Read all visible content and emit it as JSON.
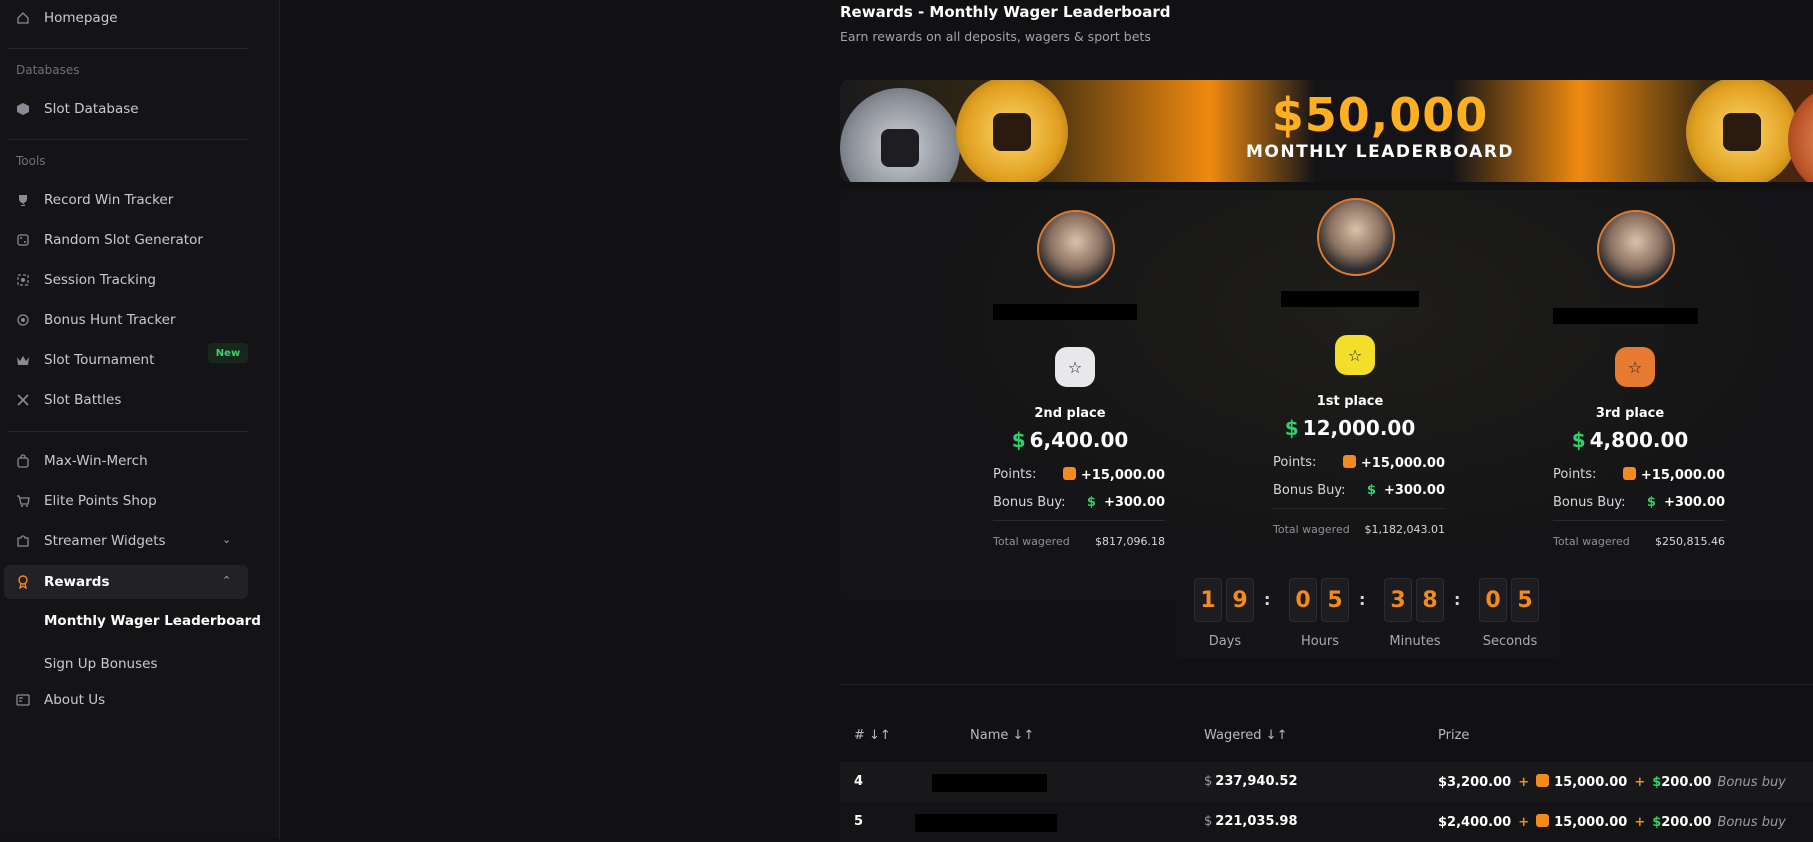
{
  "sidebar": {
    "homepage": "Homepage",
    "databases_title": "Databases",
    "slot_database": "Slot Database",
    "tools_title": "Tools",
    "record_win_tracker": "Record Win Tracker",
    "random_slot_generator": "Random Slot Generator",
    "session_tracking": "Session Tracking",
    "bonus_hunt_tracker": "Bonus Hunt Tracker",
    "slot_tournament": "Slot Tournament",
    "new_badge": "New",
    "slot_battles": "Slot Battles",
    "max_win_merch": "Max-Win-Merch",
    "elite_points_shop": "Elite Points Shop",
    "streamer_widgets": "Streamer Widgets",
    "rewards": "Rewards",
    "monthly_wager_leaderboard": "Monthly Wager Leaderboard",
    "sign_up_bonuses": "Sign Up Bonuses",
    "about_us": "About Us"
  },
  "header": {
    "title": "Rewards - Monthly Wager Leaderboard",
    "subtitle": "Earn rewards on all deposits, wagers & sport bets"
  },
  "banner": {
    "amount": "$50,000",
    "label": "MONTHLY LEADERBOARD"
  },
  "podium": {
    "points_label": "Points:",
    "bonus_buy_label": "Bonus Buy:",
    "total_wagered_label": "Total wagered",
    "currency": "$",
    "second": {
      "place": "2nd place",
      "amount": "6,400.00",
      "points": "+15,000.00",
      "bonus_buy": "+300.00",
      "total_wagered": "$817,096.18"
    },
    "first": {
      "place": "1st place",
      "amount": "12,000.00",
      "points": "+15,000.00",
      "bonus_buy": "+300.00",
      "total_wagered": "$1,182,043.01"
    },
    "third": {
      "place": "3rd place",
      "amount": "4,800.00",
      "points": "+15,000.00",
      "bonus_buy": "+300.00",
      "total_wagered": "$250,815.46"
    }
  },
  "countdown": {
    "days": [
      "1",
      "9"
    ],
    "hours": [
      "0",
      "5"
    ],
    "minutes": [
      "3",
      "8"
    ],
    "seconds": [
      "0",
      "5"
    ],
    "separator": ":",
    "labels": {
      "days": "Days",
      "hours": "Hours",
      "minutes": "Minutes",
      "seconds": "Seconds"
    }
  },
  "table": {
    "headers": {
      "rank": "# ↓↑",
      "name": "Name ↓↑",
      "wagered": "Wagered ↓↑",
      "prize": "Prize"
    },
    "rows": [
      {
        "rank": "4",
        "wagered": "237,940.52",
        "prize_cash": "$3,200.00",
        "prize_points": "15,000.00",
        "prize_bonus": "200.00",
        "bonus_label": "Bonus buy"
      },
      {
        "rank": "5",
        "wagered": "221,035.98",
        "prize_cash": "$2,400.00",
        "prize_points": "15,000.00",
        "prize_bonus": "200.00",
        "bonus_label": "Bonus buy"
      }
    ],
    "currency": "$",
    "plus": "+"
  },
  "colors": {
    "accent_orange": "#f28a1e",
    "accent_green": "#2fd06a",
    "background": "#111113"
  }
}
